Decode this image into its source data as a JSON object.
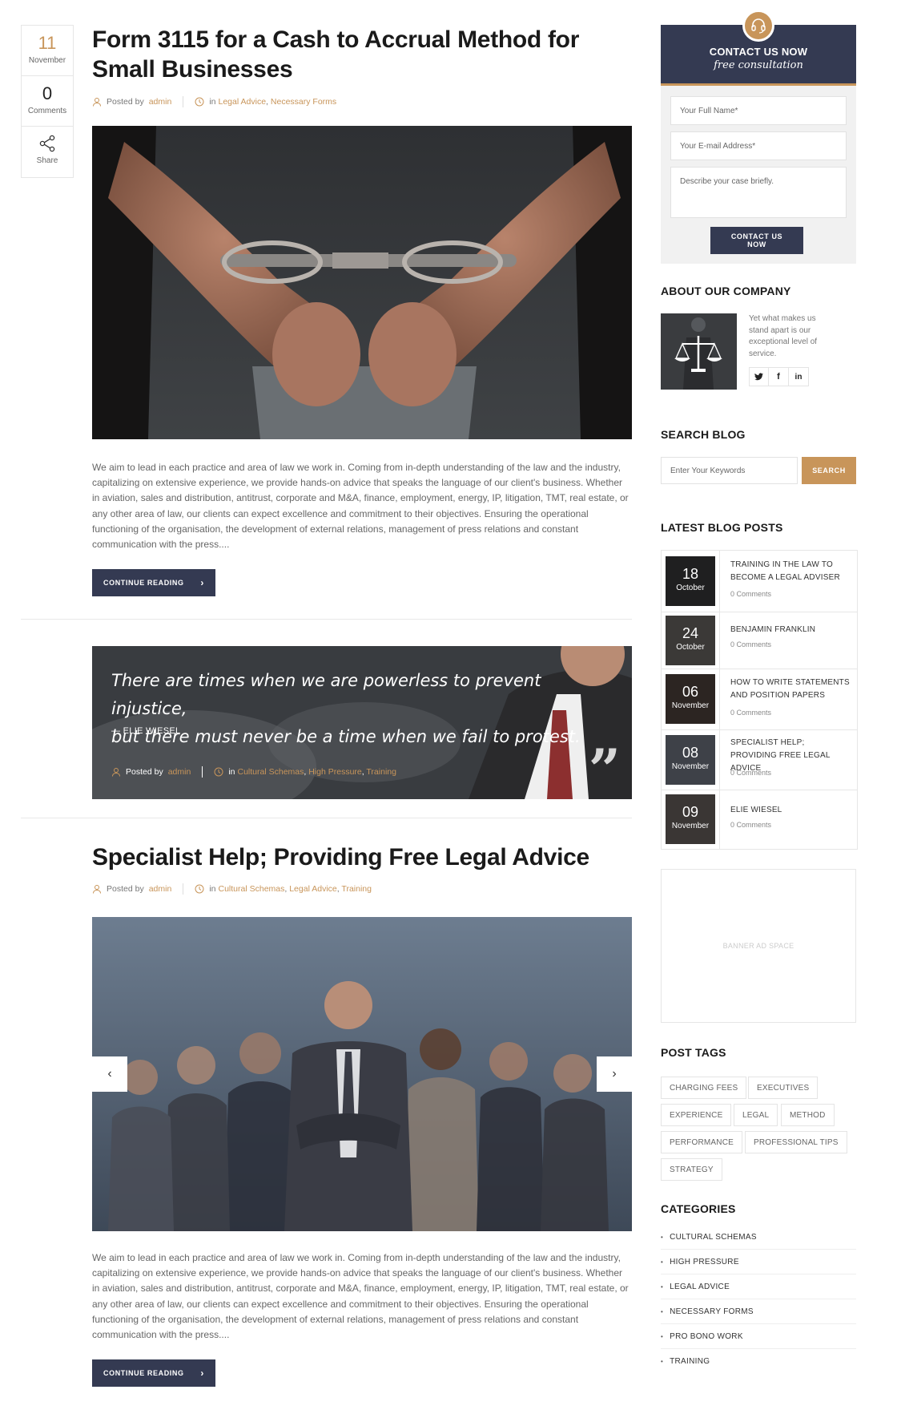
{
  "post1": {
    "date_day": "11",
    "date_month": "November",
    "comments_count": "0",
    "comments_label": "Comments",
    "share_label": "Share",
    "title": "Form 3115 for a Cash to Accrual Method for Small Businesses",
    "posted_by_label": "Posted by",
    "author": "admin",
    "in_label": "in",
    "categories": [
      "Legal Advice",
      "Necessary Forms"
    ],
    "excerpt": "We aim to lead in each practice and area of law we work in. Coming from in-depth understanding of the law and the industry, capitalizing on extensive experience, we provide hands-on advice that speaks the language of our client's business. Whether in aviation, sales and distribution, antitrust, corporate and M&A, finance, employment, energy, IP, litigation, TMT, real estate, or any other area of law, our clients can expect excellence and commitment to their objectives. Ensuring the operational functioning of the organisation, the development of external relations, management of press relations and constant communication with the press....",
    "continue_label": "CONTINUE READING"
  },
  "quote_post": {
    "quote_line1": "There are times when we are powerless to prevent injustice,",
    "quote_line2": "but there must never be a time when we fail to protest.",
    "quote_author": "— ELIE WIESEL",
    "posted_by_label": "Posted by",
    "author": "admin",
    "in_label": "in",
    "categories": [
      "Cultural Schemas",
      "High Pressure",
      "Training"
    ]
  },
  "post2": {
    "title": "Specialist Help; Providing Free Legal Advice",
    "posted_by_label": "Posted by",
    "author": "admin",
    "in_label": "in",
    "categories": [
      "Cultural Schemas",
      "Legal Advice",
      "Training"
    ],
    "excerpt": "We aim to lead in each practice and area of law we work in. Coming from in-depth understanding of the law and the industry, capitalizing on extensive experience, we provide hands-on advice that speaks the language of our client's business. Whether in aviation, sales and distribution, antitrust, corporate and M&A, finance, employment, energy, IP, litigation, TMT, real estate, or any other area of law, our clients can expect excellence and commitment to their objectives. Ensuring the operational functioning of the organisation, the development of external relations, management of press relations and constant communication with the press....",
    "continue_label": "CONTINUE READING"
  },
  "sidebar": {
    "contact": {
      "title": "CONTACT US NOW",
      "subtitle": "free consultation",
      "name_placeholder": "Your Full Name*",
      "email_placeholder": "Your E-mail Address*",
      "message_placeholder": "Describe your case briefly.",
      "submit_label": "CONTACT US NOW"
    },
    "about": {
      "title": "ABOUT OUR COMPANY",
      "text": "Yet what makes us stand apart is our exceptional level of service.",
      "social": [
        "twitter-icon",
        "facebook-icon",
        "linkedin-icon"
      ]
    },
    "search": {
      "title": "SEARCH BLOG",
      "placeholder": "Enter Your Keywords",
      "button_label": "SEARCH"
    },
    "latest": {
      "title": "LATEST BLOG POSTS",
      "posts": [
        {
          "day": "18",
          "month": "October",
          "title": "TRAINING IN THE LAW TO BECOME A LEGAL ADVISER",
          "comments": "0 Comments"
        },
        {
          "day": "24",
          "month": "October",
          "title": "BENJAMIN FRANKLIN",
          "comments": "0 Comments"
        },
        {
          "day": "06",
          "month": "November",
          "title": "HOW TO WRITE STATEMENTS AND POSITION PAPERS",
          "comments": "0 Comments"
        },
        {
          "day": "08",
          "month": "November",
          "title": "SPECIALIST HELP; PROVIDING FREE LEGAL ADVICE",
          "comments": "0 Comments"
        },
        {
          "day": "09",
          "month": "November",
          "title": "ELIE WIESEL",
          "comments": "0 Comments"
        }
      ]
    },
    "banner_text": "BANNER AD SPACE",
    "tags": {
      "title": "POST TAGS",
      "items": [
        "CHARGING FEES",
        "EXECUTIVES",
        "EXPERIENCE",
        "LEGAL",
        "METHOD",
        "PERFORMANCE",
        "PROFESSIONAL TIPS",
        "STRATEGY"
      ]
    },
    "categories": {
      "title": "CATEGORIES",
      "items": [
        "CULTURAL SCHEMAS",
        "HIGH PRESSURE",
        "LEGAL ADVICE",
        "NECESSARY FORMS",
        "PRO BONO WORK",
        "TRAINING"
      ]
    }
  },
  "colors": {
    "accent": "#c8955a",
    "navy": "#343a52"
  }
}
